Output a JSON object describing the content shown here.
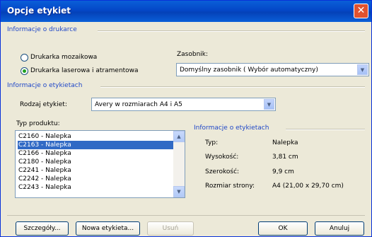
{
  "dialog": {
    "title": "Opcje etykiet",
    "close_glyph": "✕"
  },
  "printer": {
    "group_label": "Informacje o drukarce",
    "radio_continuous": "Drukarka mozaikowa",
    "radio_laser": "Drukarka laserowa i atramentowa",
    "selected": "laser",
    "tray_label": "Zasobnik:",
    "tray_value": "Domyślny zasobnik ( Wybór automatyczny)"
  },
  "labels": {
    "group_label": "Informacje o etykietach",
    "vendor_label": "Rodzaj etykiet:",
    "vendor_value": "Avery w rozmiarach A4 i A5",
    "product_label": "Typ produktu:",
    "products": [
      "C2160 - Nalepka",
      "C2163 - Nalepka",
      "C2166 - Nalepka",
      "C2180 - Nalepka",
      "C2241 - Nalepka",
      "C2242 - Nalepka",
      "C2243 - Nalepka"
    ],
    "selected_index": 1
  },
  "info": {
    "group_label": "Informacje o etykietach",
    "type_label": "Typ:",
    "type_value": "Nalepka",
    "height_label": "Wysokość:",
    "height_value": "3,81 cm",
    "width_label": "Szerokość:",
    "width_value": "9,9 cm",
    "page_label": "Rozmiar strony:",
    "page_value": "A4 (21,00 x 29,70 cm)"
  },
  "buttons": {
    "details": "Szczegóły...",
    "new_label": "Nowa etykieta...",
    "delete": "Usuń",
    "ok": "OK",
    "cancel": "Anuluj"
  },
  "icons": {
    "dropdown": "chevron-down-icon",
    "scroll_up": "arrow-up-icon",
    "scroll_down": "arrow-down-icon"
  }
}
